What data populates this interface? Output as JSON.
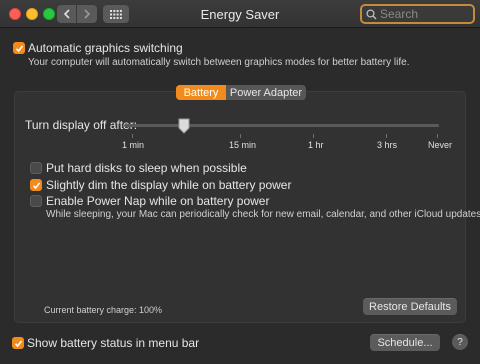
{
  "window": {
    "title": "Energy Saver",
    "search_placeholder": "Search"
  },
  "top": {
    "auto_graphics": {
      "label": "Automatic graphics switching",
      "checked": true,
      "description": "Your computer will automatically switch between graphics modes for better battery life."
    }
  },
  "tabs": [
    {
      "label": "Battery",
      "selected": true
    },
    {
      "label": "Power Adapter",
      "selected": false
    }
  ],
  "battery": {
    "display_off_label": "Turn display off after:",
    "tick_labels": [
      "1 min",
      "15 min",
      "1 hr",
      "3 hrs",
      "Never"
    ],
    "options": [
      {
        "label": "Put hard disks to sleep when possible",
        "checked": false
      },
      {
        "label": "Slightly dim the display while on battery power",
        "checked": true
      },
      {
        "label": "Enable Power Nap while on battery power",
        "checked": false,
        "description": "While sleeping, your Mac can periodically check for new email, calendar, and other iCloud updates"
      }
    ],
    "charge_text": "Current battery charge: 100%",
    "restore_label": "Restore Defaults"
  },
  "bottom": {
    "show_status": {
      "label": "Show battery status in menu bar",
      "checked": true
    },
    "schedule_label": "Schedule...",
    "help_label": "?"
  },
  "colors": {
    "accent": "#f28b1b",
    "background": "#2b2b2b",
    "panel": "#323232"
  }
}
